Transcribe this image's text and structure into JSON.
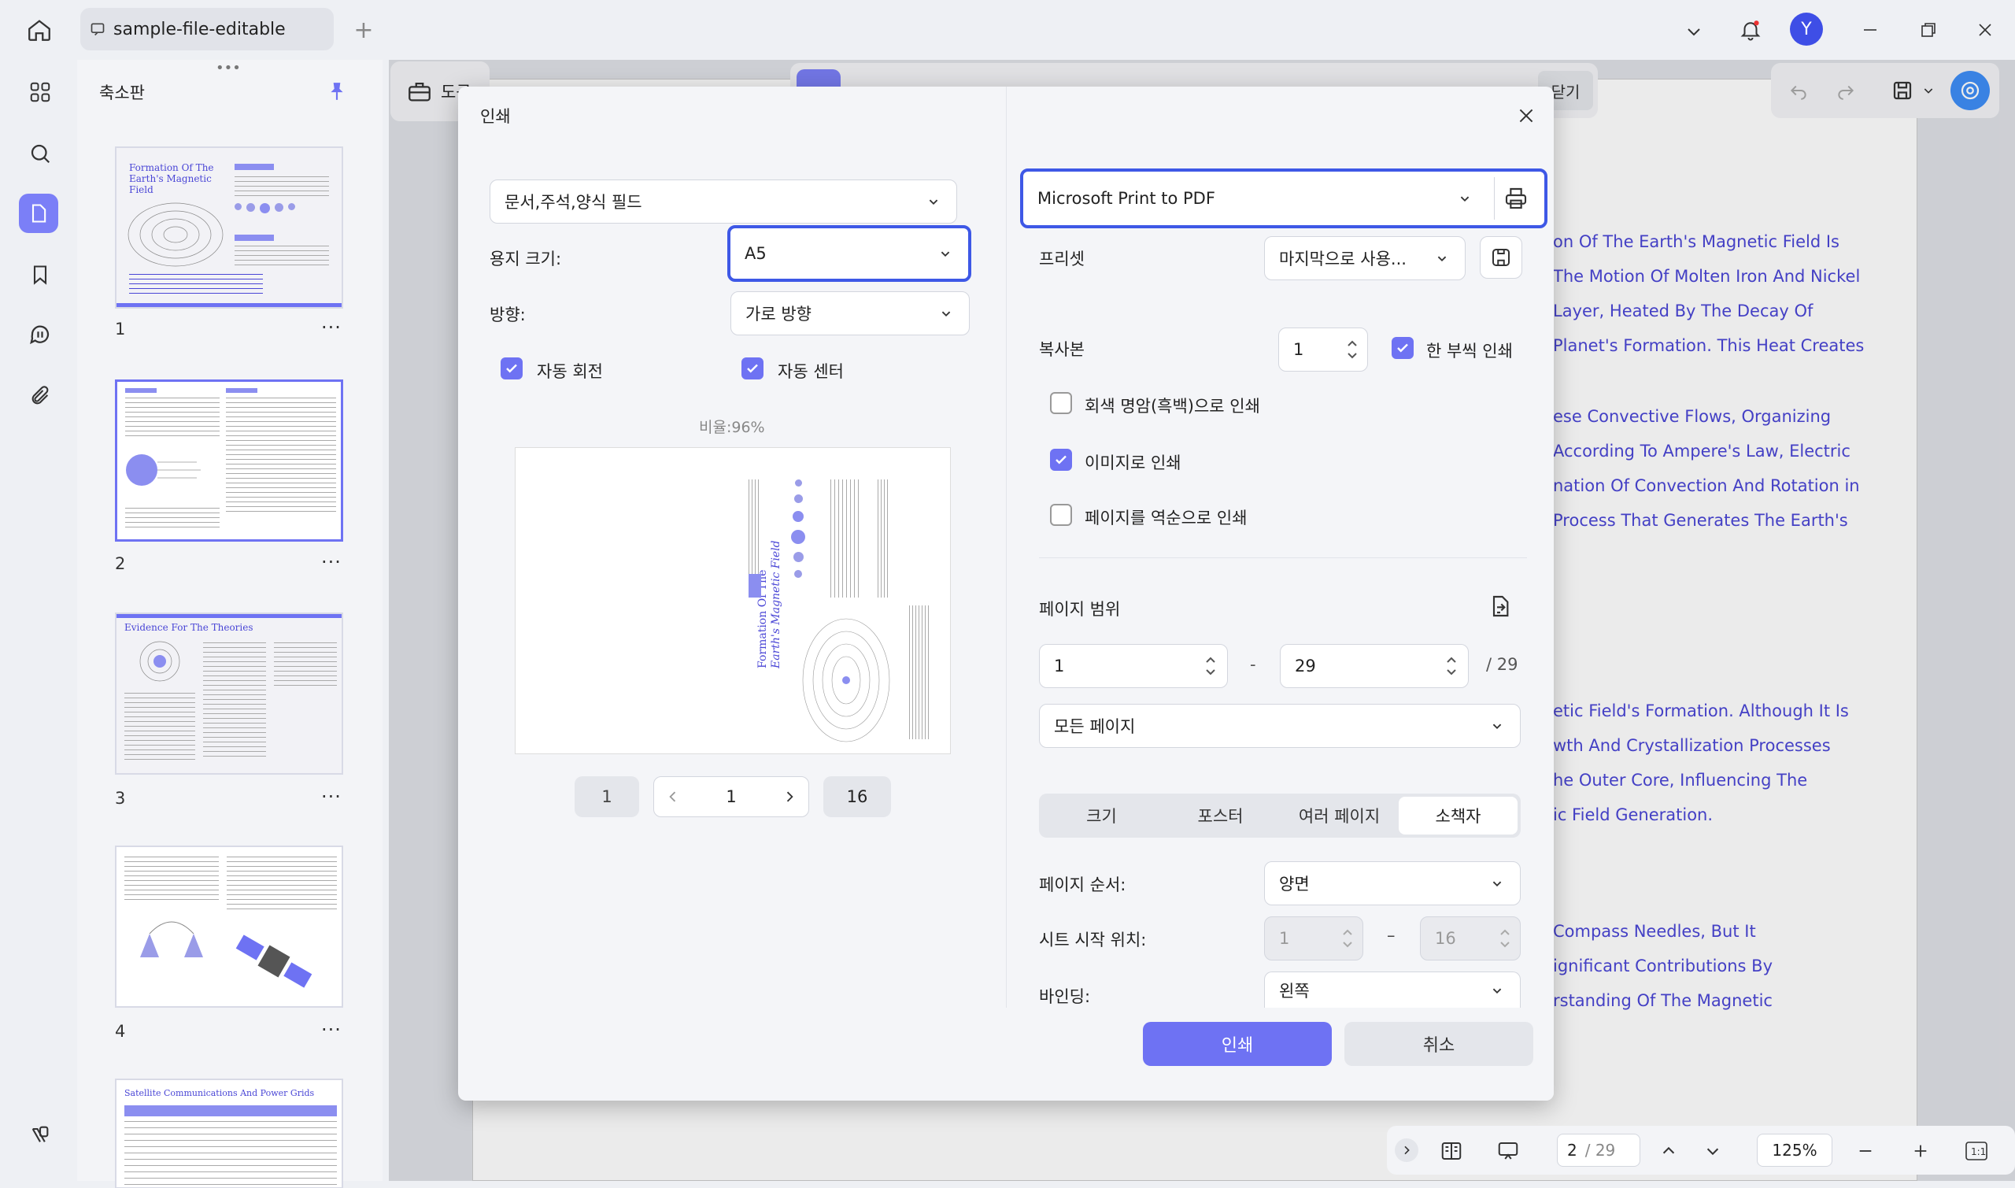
{
  "titlebar": {
    "tab_title": "sample-file-editable",
    "avatar_letter": "Y",
    "accent": "#3e4ee6"
  },
  "thumbnails": {
    "title": "축소판",
    "items": [
      {
        "num": "1",
        "heading": "Formation Of The Earth's Magnetic Field"
      },
      {
        "num": "2",
        "heading": ""
      },
      {
        "num": "3",
        "heading": "Evidence For The Theories"
      },
      {
        "num": "4",
        "heading": ""
      },
      {
        "num": "",
        "heading": "Satellite Communications And Power Grids"
      }
    ],
    "more": "···"
  },
  "toolbar": {
    "tool_label": "도구",
    "close_label": "닫기"
  },
  "document": {
    "lines": [
      "on Of The Earth's Magnetic Field Is",
      "The Motion Of Molten Iron And Nickel",
      "Layer, Heated By The Decay Of",
      "Planet's Formation. This Heat Creates",
      "ese Convective Flows, Organizing",
      "According To Ampere's Law, Electric",
      "nation Of Convection And Rotation in",
      "Process That Generates The Earth's",
      "etic Field's Formation. Although It Is",
      "wth And Crystallization Processes",
      "he Outer Core, Influencing The",
      "ic Field Generation.",
      "Compass Needles, But It",
      "ignificant Contributions By",
      "rstanding Of The Magnetic"
    ]
  },
  "dialog": {
    "title": "인쇄",
    "content_select": "문서,주석,양식 필드",
    "paper_size_label": "용지 크기:",
    "paper_size_value": "A5",
    "orientation_label": "방향:",
    "orientation_value": "가로 방향",
    "auto_rotate": {
      "label": "자동 회전",
      "checked": true
    },
    "auto_center": {
      "label": "자동 센터",
      "checked": true
    },
    "scale_label": "비율:96%",
    "preview": {
      "title_line1": "Formation Of The",
      "title_line2": "Earth's Magnetic Field"
    },
    "pager": {
      "first": "1",
      "current": "1",
      "last": "16"
    },
    "printer_value": "Microsoft Print to PDF",
    "preset_label": "프리셋",
    "preset_value": "마지막으로 사용...",
    "copies_label": "복사본",
    "copies_value": "1",
    "collate": {
      "label": "한 부씩 인쇄",
      "checked": true
    },
    "grayscale": {
      "label": "회색 명암(흑백)으로 인쇄",
      "checked": false
    },
    "as_image": {
      "label": "이미지로 인쇄",
      "checked": true
    },
    "reverse": {
      "label": "페이지를 역순으로 인쇄",
      "checked": false
    },
    "page_range_label": "페이지 범위",
    "range_from": "1",
    "range_dash": "-",
    "range_to": "29",
    "range_total": "/ 29",
    "range_mode": "모든 페이지",
    "modes": [
      "크기",
      "포스터",
      "여러 페이지",
      "소책자"
    ],
    "active_mode": "소책자",
    "page_order_label": "페이지 순서:",
    "page_order_value": "양면",
    "sheet_start_label": "시트 시작 위치:",
    "sheet_from": "1",
    "sheet_dash": "–",
    "sheet_to": "16",
    "binding_label": "바인딩:",
    "binding_value": "왼쪽",
    "print_button": "인쇄",
    "cancel_button": "취소"
  },
  "bottombar": {
    "page_current": "2",
    "page_total": "/ 29",
    "zoom": "125%"
  },
  "colors": {
    "accent": "#6e72f3",
    "highlight": "#3e58e6",
    "doc_text": "#4a46d6"
  }
}
